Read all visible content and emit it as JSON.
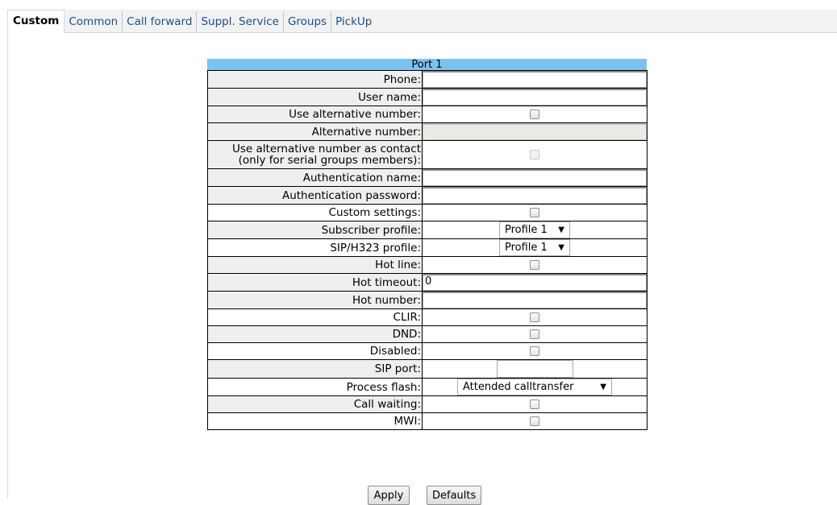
{
  "tabs": [
    "Custom",
    "Common",
    "Call forward",
    "Suppl. Service",
    "Groups",
    "PickUp"
  ],
  "form": {
    "title": "Port 1",
    "rows": [
      {
        "label": "Phone:",
        "control": "text",
        "value": ""
      },
      {
        "label": "User name:",
        "control": "text",
        "value": ""
      },
      {
        "label": "Use alternative number:",
        "control": "checkbox",
        "checked": false
      },
      {
        "label": "Alternative number:",
        "control": "text-disabled",
        "value": ""
      },
      {
        "label": "Use alternative number as contact",
        "label2": "(only for serial groups members):",
        "control": "checkbox-disabled",
        "checked": false
      },
      {
        "label": "Authentication name:",
        "control": "text",
        "value": ""
      },
      {
        "label": "Authentication password:",
        "control": "text",
        "value": ""
      },
      {
        "label": "Custom settings:",
        "control": "checkbox",
        "checked": false
      },
      {
        "label": "Subscriber profile:",
        "control": "select",
        "value": "Profile 1"
      },
      {
        "label": "SIP/H323 profile:",
        "control": "select",
        "value": "Profile 1"
      },
      {
        "label": "Hot line:",
        "control": "checkbox",
        "checked": false
      },
      {
        "label": "Hot timeout:",
        "control": "text",
        "value": "0"
      },
      {
        "label": "Hot number:",
        "control": "text",
        "value": ""
      },
      {
        "label": "CLIR:",
        "control": "checkbox",
        "checked": false
      },
      {
        "label": "DND:",
        "control": "checkbox",
        "checked": false
      },
      {
        "label": "Disabled:",
        "control": "checkbox",
        "checked": false
      },
      {
        "label": "SIP port:",
        "control": "short-text",
        "value": ""
      },
      {
        "label": "Process flash:",
        "control": "select-wide",
        "value": "Attended calltransfer"
      },
      {
        "label": "Call waiting:",
        "control": "checkbox",
        "checked": false
      },
      {
        "label": "MWI:",
        "control": "checkbox",
        "checked": false
      }
    ]
  },
  "buttons": {
    "apply": "Apply",
    "defaults": "Defaults"
  },
  "colors": {
    "header": "#7cc2f0",
    "tab_link": "#1a4f8c",
    "label_shade": "#efefef"
  }
}
